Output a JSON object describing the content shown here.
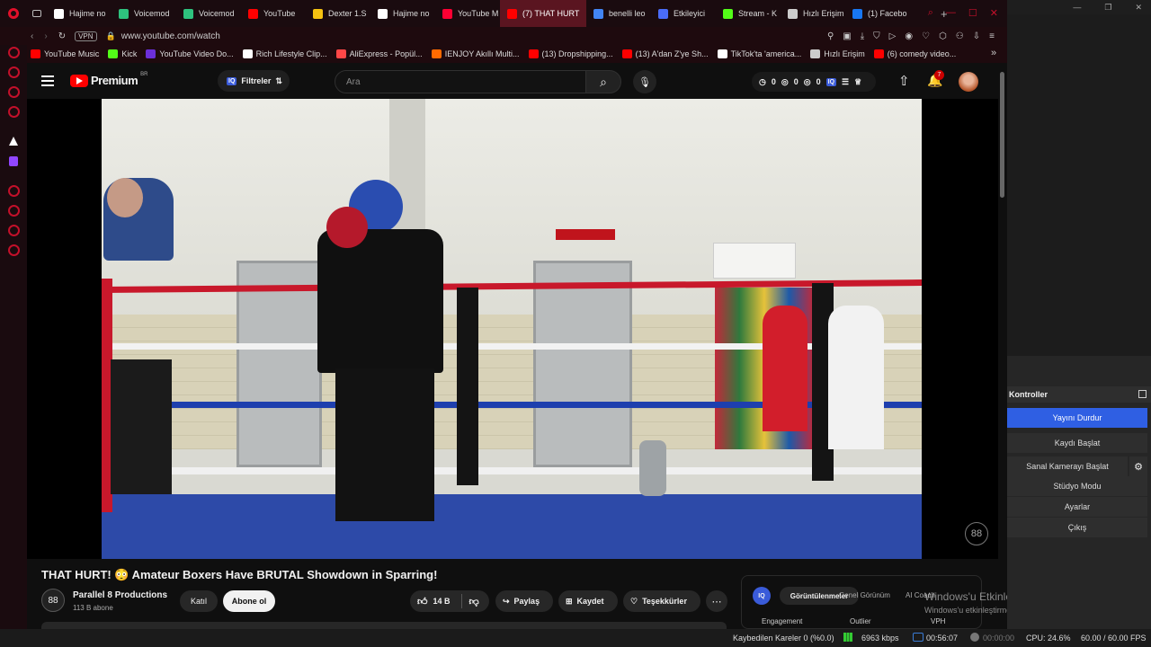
{
  "tabs": [
    {
      "label": "Hajime no",
      "color": "#ffffff"
    },
    {
      "label": "Voicemod",
      "color": "#2ec27e"
    },
    {
      "label": "Voicemod",
      "color": "#2ec27e"
    },
    {
      "label": "YouTube",
      "color": "#ff0000"
    },
    {
      "label": "Dexter 1.S",
      "color": "#f5c211"
    },
    {
      "label": "Hajime no",
      "color": "#ffffff"
    },
    {
      "label": "YouTube M",
      "color": "#ff0033"
    },
    {
      "label": "(7) THAT HURT",
      "color": "#ff0000"
    },
    {
      "label": "benelli leo",
      "color": "#4285f4"
    },
    {
      "label": "Etkileyici",
      "color": "#4a6cf7"
    },
    {
      "label": "Stream - K",
      "color": "#53fc18"
    },
    {
      "label": "Hızlı Erişim",
      "color": "#cccccc"
    },
    {
      "label": "(1) Facebo",
      "color": "#1877f2"
    }
  ],
  "address": {
    "vpn": "VPN",
    "url": "www.youtube.com/watch"
  },
  "bookmarks": [
    {
      "label": "YouTube Music",
      "color": "#ff0000"
    },
    {
      "label": "Kick",
      "color": "#53fc18"
    },
    {
      "label": "YouTube Video Do...",
      "color": "#6b2fd9"
    },
    {
      "label": "Rich Lifestyle Clip...",
      "color": "#ffffff"
    },
    {
      "label": "AliExpress - Popül...",
      "color": "#ff4747"
    },
    {
      "label": "IENJOY Akıllı Multi...",
      "color": "#ff6a00"
    },
    {
      "label": "(13) Dropshipping...",
      "color": "#ff0000"
    },
    {
      "label": "(13) A'dan Z'ye Sh...",
      "color": "#ff0000"
    },
    {
      "label": "TikTok'ta 'america...",
      "color": "#ffffff"
    },
    {
      "label": "Hızlı Erişim",
      "color": "#cccccc"
    },
    {
      "label": "(6) comedy video...",
      "color": "#ff0000"
    }
  ],
  "yt": {
    "logo": "Premium",
    "logo_sup": "BR",
    "filters": "Filtreler",
    "search_placeholder": "Ara",
    "counters": [
      "0",
      "0",
      "0"
    ],
    "notif_count": "7",
    "watermark": "88"
  },
  "video_info": {
    "title": "THAT HURT! 😳 Amateur Boxers Have BRUTAL Showdown in Sparring!",
    "channel": "Parallel 8 Productions",
    "channel_avatar": "88",
    "subs": "113 B abone",
    "join": "Katıl",
    "subscribe": "Abone ol",
    "likes": "14 B",
    "share": "Paylaş",
    "save": "Kaydet",
    "thanks": "Teşekkürler"
  },
  "iq_panel": {
    "tabs": [
      "Görüntülenmeler",
      "Genel Görünüm",
      "AI Coach"
    ],
    "cols": [
      "Engagement",
      "Outlier",
      "VPH"
    ]
  },
  "activation": {
    "title": "Windows'u Etkinleştir",
    "sub": "Windows'u etkinleştirmek için Ayarlar'a gidin."
  },
  "obs": {
    "controls_title": "Kontroller",
    "buttons": [
      "Yayını Durdur",
      "Kaydı Başlat",
      "Sanal Kamerayı Başlat",
      "Stüdyo Modu",
      "Ayarlar",
      "Çıkış"
    ]
  },
  "status": {
    "dropped": "Kaybedilen Kareler 0 (%0.0)",
    "bitrate": "6963 kbps",
    "live_time": "00:56:07",
    "rec_time": "00:00:00",
    "cpu": "CPU: 24.6%",
    "fps": "60.00 / 60.00 FPS"
  }
}
